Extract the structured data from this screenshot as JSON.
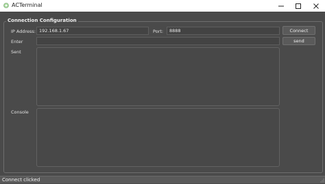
{
  "window": {
    "title": "ACTerminal",
    "icon": "app-icon",
    "controls": [
      "minimize-icon",
      "maximize-icon",
      "close-icon"
    ]
  },
  "group": {
    "title": "Connection Configuration"
  },
  "form": {
    "ip_label": "IP Address:",
    "ip_value": "192.168.1.67",
    "port_label": "Port:",
    "port_value": "8888",
    "connect_label": "Connect",
    "enter_label": "Enter",
    "enter_value": "",
    "send_label": "send",
    "sent_label": "Sent",
    "console_label": "Console"
  },
  "status": {
    "text": "Connect clicked"
  },
  "colors": {
    "background": "#4a4a4a",
    "titlebar": "#ffffff",
    "status_bar": "#5a5a5a"
  }
}
